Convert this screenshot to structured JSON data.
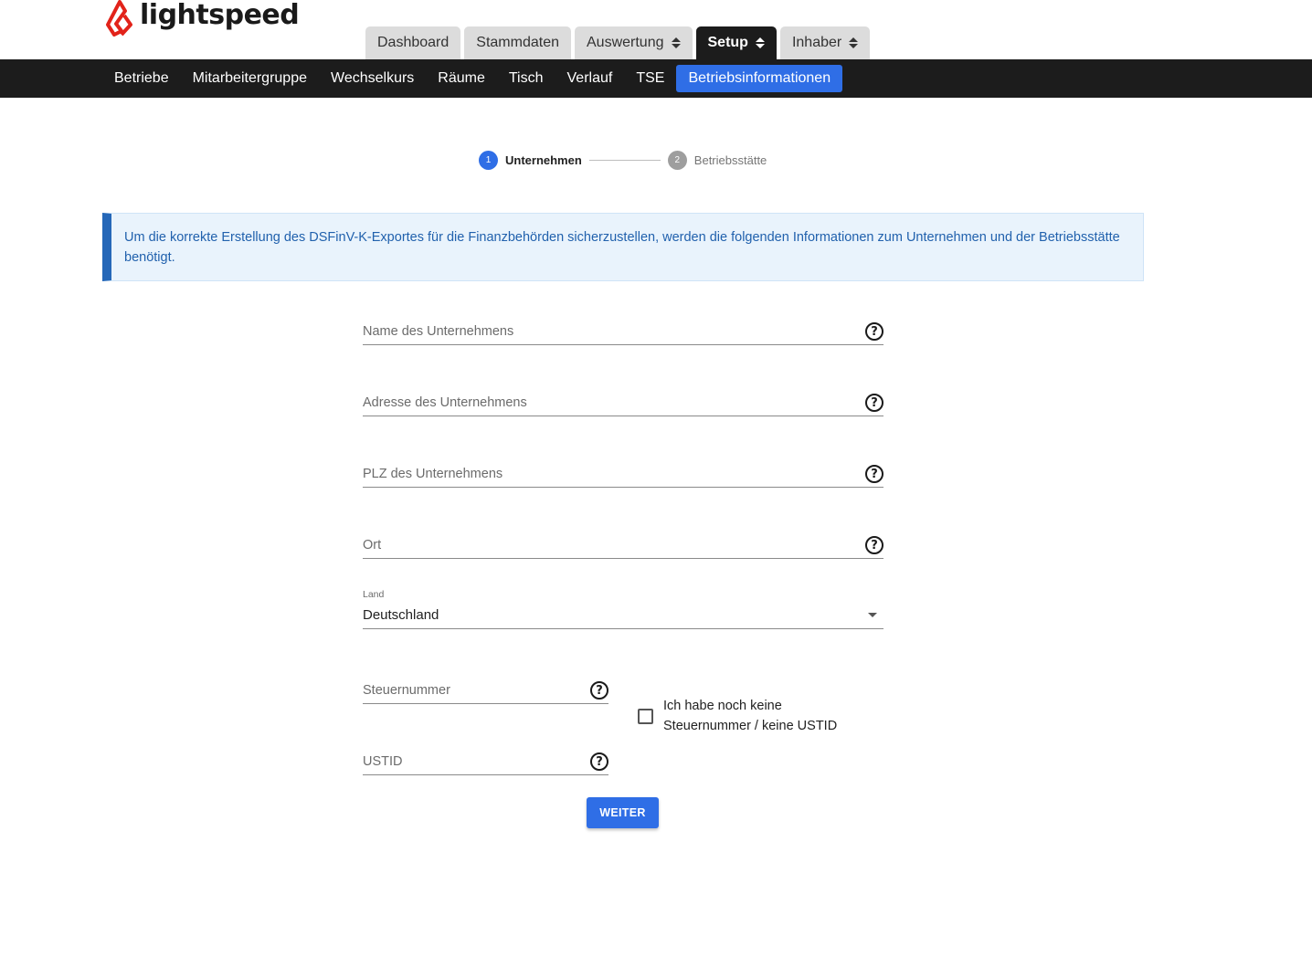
{
  "brand": {
    "name": "lightspeed",
    "color": "#e2231a"
  },
  "top_tabs": [
    {
      "label": "Dashboard",
      "dropdown": false,
      "active": false
    },
    {
      "label": "Stammdaten",
      "dropdown": false,
      "active": false
    },
    {
      "label": "Auswertung",
      "dropdown": true,
      "active": false
    },
    {
      "label": "Setup",
      "dropdown": true,
      "active": true
    },
    {
      "label": "Inhaber",
      "dropdown": true,
      "active": false
    }
  ],
  "subnav": [
    {
      "label": "Betriebe",
      "active": false
    },
    {
      "label": "Mitarbeitergruppe",
      "active": false
    },
    {
      "label": "Wechselkurs",
      "active": false
    },
    {
      "label": "Räume",
      "active": false
    },
    {
      "label": "Tisch",
      "active": false
    },
    {
      "label": "Verlauf",
      "active": false
    },
    {
      "label": "TSE",
      "active": false
    },
    {
      "label": "Betriebsinformationen",
      "active": true
    }
  ],
  "stepper": [
    {
      "number": "1",
      "label": "Unternehmen",
      "active": true
    },
    {
      "number": "2",
      "label": "Betriebsstätte",
      "active": false
    }
  ],
  "info": {
    "text": "Um die korrekte Erstellung des DSFinV-K-Exportes für die Finanzbehörden sicherzustellen, werden die folgenden Informationen zum Unternehmen und der Betriebsstätte benötigt."
  },
  "form": {
    "company_name": {
      "label": "Name des Unternehmens",
      "value": ""
    },
    "company_address": {
      "label": "Adresse des Unternehmens",
      "value": ""
    },
    "company_zip": {
      "label": "PLZ des Unternehmens",
      "value": ""
    },
    "city": {
      "label": "Ort",
      "value": ""
    },
    "country": {
      "label": "Land",
      "value": "Deutschland"
    },
    "tax_number": {
      "label": "Steuernummer",
      "value": ""
    },
    "vat_id": {
      "label": "USTID",
      "value": ""
    },
    "no_tax_checkbox": {
      "label": "Ich habe noch keine Steuernummer / keine USTID",
      "checked": false
    },
    "help_glyph": "?",
    "submit_label": "WEITER"
  },
  "colors": {
    "accent": "#2f6ee6",
    "nav_bg": "#1c1c1c",
    "info_bg": "#e9f3fc",
    "info_text": "#2161ad",
    "info_border": "#2567b8"
  }
}
